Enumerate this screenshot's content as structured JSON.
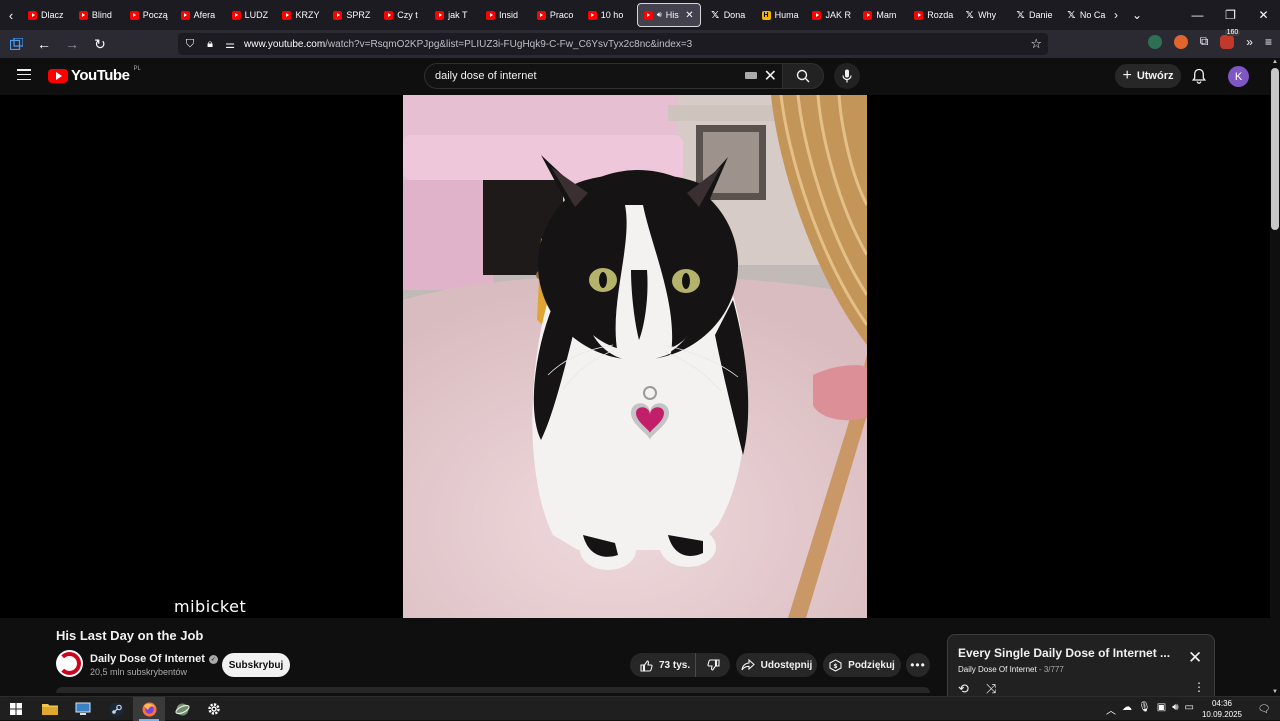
{
  "browser": {
    "tabs": [
      {
        "title": "Dlacz",
        "icon": "youtube-icon"
      },
      {
        "title": "Blind",
        "icon": "youtube-icon"
      },
      {
        "title": "Począ",
        "icon": "youtube-icon"
      },
      {
        "title": "Afera",
        "icon": "youtube-icon"
      },
      {
        "title": "LUDZ",
        "icon": "youtube-icon"
      },
      {
        "title": "KRZY",
        "icon": "youtube-icon"
      },
      {
        "title": "SPRZ",
        "icon": "youtube-icon"
      },
      {
        "title": "Czy t",
        "icon": "youtube-icon"
      },
      {
        "title": "jak T",
        "icon": "youtube-icon"
      },
      {
        "title": "Insid",
        "icon": "youtube-icon"
      },
      {
        "title": "Praco",
        "icon": "youtube-icon"
      },
      {
        "title": "10 ho",
        "icon": "youtube-icon"
      },
      {
        "title": "His",
        "icon": "youtube-icon",
        "active": true
      },
      {
        "title": "Dona",
        "icon": "x-icon"
      },
      {
        "title": "Huma",
        "icon": "humata-icon"
      },
      {
        "title": "JAK R",
        "icon": "youtube-icon"
      },
      {
        "title": "Mam",
        "icon": "youtube-icon"
      },
      {
        "title": "Rozda",
        "icon": "youtube-icon"
      },
      {
        "title": "Why",
        "icon": "x-icon"
      },
      {
        "title": "Danie",
        "icon": "x-icon"
      },
      {
        "title": "No Ca",
        "icon": "x-icon"
      }
    ],
    "url_domain": "www.youtube.com",
    "url_path": "/watch?v=RsqmO2KPJpg&list=PLIUZ3i-FUgHqk9-C-Fw_C6YsvTyx2c8nc&index=3",
    "extension_badge": "160"
  },
  "youtube": {
    "logo_text": "YouTube",
    "country": "PL",
    "search_value": "daily dose of internet",
    "create_label": "Utwórz",
    "avatar_letter": "K"
  },
  "video": {
    "caption": "mibicket",
    "title": "His Last Day on the Job",
    "channel": "Daily Dose Of Internet",
    "subscribers": "20,5 mln subskrybentów",
    "subscribe_label": "Subskrybuj",
    "likes": "73 tys.",
    "share_label": "Udostępnij",
    "thanks_label": "Podziękuj"
  },
  "playlist": {
    "title": "Every Single Daily Dose of Internet ...",
    "owner": "Daily Dose Of Internet",
    "position": " - 3/777"
  },
  "taskbar": {
    "time": "04:36",
    "date": "10.09.2025"
  }
}
